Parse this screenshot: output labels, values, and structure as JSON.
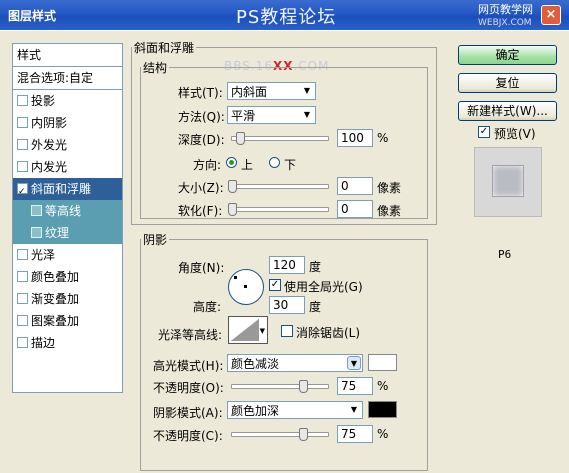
{
  "window": {
    "title": "图层样式",
    "site_title": "PS教程论坛",
    "site_url_a": "BBS.16",
    "site_url_b": "XX",
    "site_url_c": ".COM",
    "logo_text": "网页教学网",
    "logo_sub": "WEBJX.COM",
    "close_label": "×"
  },
  "sidebar": {
    "header": "样式",
    "blend_label": "混合选项:自定",
    "items": [
      {
        "label": "投影",
        "checked": false
      },
      {
        "label": "内阴影",
        "checked": false
      },
      {
        "label": "外发光",
        "checked": false
      },
      {
        "label": "内发光",
        "checked": false
      },
      {
        "label": "斜面和浮雕",
        "checked": true,
        "selected": true
      },
      {
        "label": "等高线",
        "checked": false,
        "sub": true
      },
      {
        "label": "纹理",
        "checked": false,
        "sub": true
      },
      {
        "label": "光泽",
        "checked": false
      },
      {
        "label": "颜色叠加",
        "checked": false
      },
      {
        "label": "渐变叠加",
        "checked": false
      },
      {
        "label": "图案叠加",
        "checked": false
      },
      {
        "label": "描边",
        "checked": false
      }
    ]
  },
  "bevel": {
    "group_title": "斜面和浮雕",
    "structure_title": "结构",
    "style_label": "样式(T):",
    "style_value": "内斜面",
    "method_label": "方法(Q):",
    "method_value": "平滑",
    "depth_label": "深度(D):",
    "depth_value": "100",
    "depth_unit": "%",
    "depth_level": 0.1,
    "direction_label": "方向:",
    "dir_up": "上",
    "dir_down": "下",
    "size_label": "大小(Z):",
    "size_value": "0",
    "size_unit": "像素",
    "soften_label": "软化(F):",
    "soften_value": "0",
    "soften_unit": "像素"
  },
  "shading": {
    "group_title": "阴影",
    "angle_label": "角度(N):",
    "angle_value": "120",
    "angle_unit": "度",
    "global_light_label": "使用全局光(G)",
    "global_light_checked": true,
    "altitude_label": "高度:",
    "altitude_value": "30",
    "altitude_unit": "度",
    "gloss_contour_label": "光泽等高线:",
    "anti_alias_label": "消除锯齿(L)",
    "anti_alias_checked": false,
    "highlight_mode_label": "高光模式(H):",
    "highlight_mode_value": "颜色减淡",
    "highlight_color": "#ffffff",
    "highlight_opacity_label": "不透明度(O):",
    "highlight_opacity_value": "75",
    "highlight_opacity_unit": "%",
    "highlight_opacity_level": 0.75,
    "shadow_mode_label": "阴影模式(A):",
    "shadow_mode_value": "颜色加深",
    "shadow_color": "#000000",
    "shadow_opacity_label": "不透明度(C):",
    "shadow_opacity_value": "75",
    "shadow_opacity_unit": "%",
    "shadow_opacity_level": 0.75
  },
  "buttons": {
    "ok": "确定",
    "reset": "复位",
    "new_style": "新建样式(W)...",
    "preview_label": "预览(V)",
    "preview_checked": true
  },
  "footer_label": "P6"
}
